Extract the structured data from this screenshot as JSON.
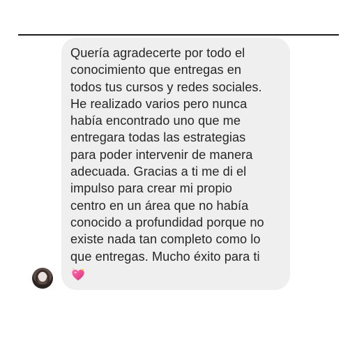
{
  "message": {
    "lines": [
      "Quería agradecerte por todo el",
      "conocimiento que entregas en",
      "todos tus cursos y redes sociales.",
      "He realizado varios pero nunca",
      "había encontrado uno que me",
      "entregara todas las estrategias",
      "para poder intervenir de manera",
      "adecuada. Gracias a ti me di el",
      "impulso para crear mi propio",
      "centro en un área que no había",
      "conocido a profundidad porque no",
      "existe nada tan completo como lo",
      "que entregas. Mucho éxito para ti"
    ],
    "emoji": "sparkling-heart-icon"
  },
  "sender": {
    "avatar": "profile-photo"
  },
  "colors": {
    "bubble_bg": "#efefef",
    "text": "#262626",
    "divider": "#1a1a1a",
    "heart": "#e0407a"
  }
}
